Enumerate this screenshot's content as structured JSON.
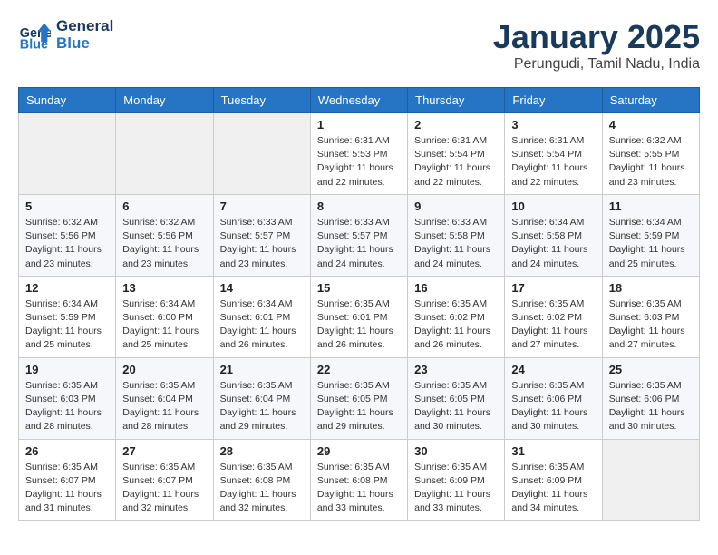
{
  "header": {
    "logo_line1": "General",
    "logo_line2": "Blue",
    "month_title": "January 2025",
    "location": "Perungudi, Tamil Nadu, India"
  },
  "weekdays": [
    "Sunday",
    "Monday",
    "Tuesday",
    "Wednesday",
    "Thursday",
    "Friday",
    "Saturday"
  ],
  "weeks": [
    [
      {
        "day": "",
        "sunrise": "",
        "sunset": "",
        "daylight": ""
      },
      {
        "day": "",
        "sunrise": "",
        "sunset": "",
        "daylight": ""
      },
      {
        "day": "",
        "sunrise": "",
        "sunset": "",
        "daylight": ""
      },
      {
        "day": "1",
        "sunrise": "Sunrise: 6:31 AM",
        "sunset": "Sunset: 5:53 PM",
        "daylight": "Daylight: 11 hours and 22 minutes."
      },
      {
        "day": "2",
        "sunrise": "Sunrise: 6:31 AM",
        "sunset": "Sunset: 5:54 PM",
        "daylight": "Daylight: 11 hours and 22 minutes."
      },
      {
        "day": "3",
        "sunrise": "Sunrise: 6:31 AM",
        "sunset": "Sunset: 5:54 PM",
        "daylight": "Daylight: 11 hours and 22 minutes."
      },
      {
        "day": "4",
        "sunrise": "Sunrise: 6:32 AM",
        "sunset": "Sunset: 5:55 PM",
        "daylight": "Daylight: 11 hours and 23 minutes."
      }
    ],
    [
      {
        "day": "5",
        "sunrise": "Sunrise: 6:32 AM",
        "sunset": "Sunset: 5:56 PM",
        "daylight": "Daylight: 11 hours and 23 minutes."
      },
      {
        "day": "6",
        "sunrise": "Sunrise: 6:32 AM",
        "sunset": "Sunset: 5:56 PM",
        "daylight": "Daylight: 11 hours and 23 minutes."
      },
      {
        "day": "7",
        "sunrise": "Sunrise: 6:33 AM",
        "sunset": "Sunset: 5:57 PM",
        "daylight": "Daylight: 11 hours and 23 minutes."
      },
      {
        "day": "8",
        "sunrise": "Sunrise: 6:33 AM",
        "sunset": "Sunset: 5:57 PM",
        "daylight": "Daylight: 11 hours and 24 minutes."
      },
      {
        "day": "9",
        "sunrise": "Sunrise: 6:33 AM",
        "sunset": "Sunset: 5:58 PM",
        "daylight": "Daylight: 11 hours and 24 minutes."
      },
      {
        "day": "10",
        "sunrise": "Sunrise: 6:34 AM",
        "sunset": "Sunset: 5:58 PM",
        "daylight": "Daylight: 11 hours and 24 minutes."
      },
      {
        "day": "11",
        "sunrise": "Sunrise: 6:34 AM",
        "sunset": "Sunset: 5:59 PM",
        "daylight": "Daylight: 11 hours and 25 minutes."
      }
    ],
    [
      {
        "day": "12",
        "sunrise": "Sunrise: 6:34 AM",
        "sunset": "Sunset: 5:59 PM",
        "daylight": "Daylight: 11 hours and 25 minutes."
      },
      {
        "day": "13",
        "sunrise": "Sunrise: 6:34 AM",
        "sunset": "Sunset: 6:00 PM",
        "daylight": "Daylight: 11 hours and 25 minutes."
      },
      {
        "day": "14",
        "sunrise": "Sunrise: 6:34 AM",
        "sunset": "Sunset: 6:01 PM",
        "daylight": "Daylight: 11 hours and 26 minutes."
      },
      {
        "day": "15",
        "sunrise": "Sunrise: 6:35 AM",
        "sunset": "Sunset: 6:01 PM",
        "daylight": "Daylight: 11 hours and 26 minutes."
      },
      {
        "day": "16",
        "sunrise": "Sunrise: 6:35 AM",
        "sunset": "Sunset: 6:02 PM",
        "daylight": "Daylight: 11 hours and 26 minutes."
      },
      {
        "day": "17",
        "sunrise": "Sunrise: 6:35 AM",
        "sunset": "Sunset: 6:02 PM",
        "daylight": "Daylight: 11 hours and 27 minutes."
      },
      {
        "day": "18",
        "sunrise": "Sunrise: 6:35 AM",
        "sunset": "Sunset: 6:03 PM",
        "daylight": "Daylight: 11 hours and 27 minutes."
      }
    ],
    [
      {
        "day": "19",
        "sunrise": "Sunrise: 6:35 AM",
        "sunset": "Sunset: 6:03 PM",
        "daylight": "Daylight: 11 hours and 28 minutes."
      },
      {
        "day": "20",
        "sunrise": "Sunrise: 6:35 AM",
        "sunset": "Sunset: 6:04 PM",
        "daylight": "Daylight: 11 hours and 28 minutes."
      },
      {
        "day": "21",
        "sunrise": "Sunrise: 6:35 AM",
        "sunset": "Sunset: 6:04 PM",
        "daylight": "Daylight: 11 hours and 29 minutes."
      },
      {
        "day": "22",
        "sunrise": "Sunrise: 6:35 AM",
        "sunset": "Sunset: 6:05 PM",
        "daylight": "Daylight: 11 hours and 29 minutes."
      },
      {
        "day": "23",
        "sunrise": "Sunrise: 6:35 AM",
        "sunset": "Sunset: 6:05 PM",
        "daylight": "Daylight: 11 hours and 30 minutes."
      },
      {
        "day": "24",
        "sunrise": "Sunrise: 6:35 AM",
        "sunset": "Sunset: 6:06 PM",
        "daylight": "Daylight: 11 hours and 30 minutes."
      },
      {
        "day": "25",
        "sunrise": "Sunrise: 6:35 AM",
        "sunset": "Sunset: 6:06 PM",
        "daylight": "Daylight: 11 hours and 30 minutes."
      }
    ],
    [
      {
        "day": "26",
        "sunrise": "Sunrise: 6:35 AM",
        "sunset": "Sunset: 6:07 PM",
        "daylight": "Daylight: 11 hours and 31 minutes."
      },
      {
        "day": "27",
        "sunrise": "Sunrise: 6:35 AM",
        "sunset": "Sunset: 6:07 PM",
        "daylight": "Daylight: 11 hours and 32 minutes."
      },
      {
        "day": "28",
        "sunrise": "Sunrise: 6:35 AM",
        "sunset": "Sunset: 6:08 PM",
        "daylight": "Daylight: 11 hours and 32 minutes."
      },
      {
        "day": "29",
        "sunrise": "Sunrise: 6:35 AM",
        "sunset": "Sunset: 6:08 PM",
        "daylight": "Daylight: 11 hours and 33 minutes."
      },
      {
        "day": "30",
        "sunrise": "Sunrise: 6:35 AM",
        "sunset": "Sunset: 6:09 PM",
        "daylight": "Daylight: 11 hours and 33 minutes."
      },
      {
        "day": "31",
        "sunrise": "Sunrise: 6:35 AM",
        "sunset": "Sunset: 6:09 PM",
        "daylight": "Daylight: 11 hours and 34 minutes."
      },
      {
        "day": "",
        "sunrise": "",
        "sunset": "",
        "daylight": ""
      }
    ]
  ]
}
